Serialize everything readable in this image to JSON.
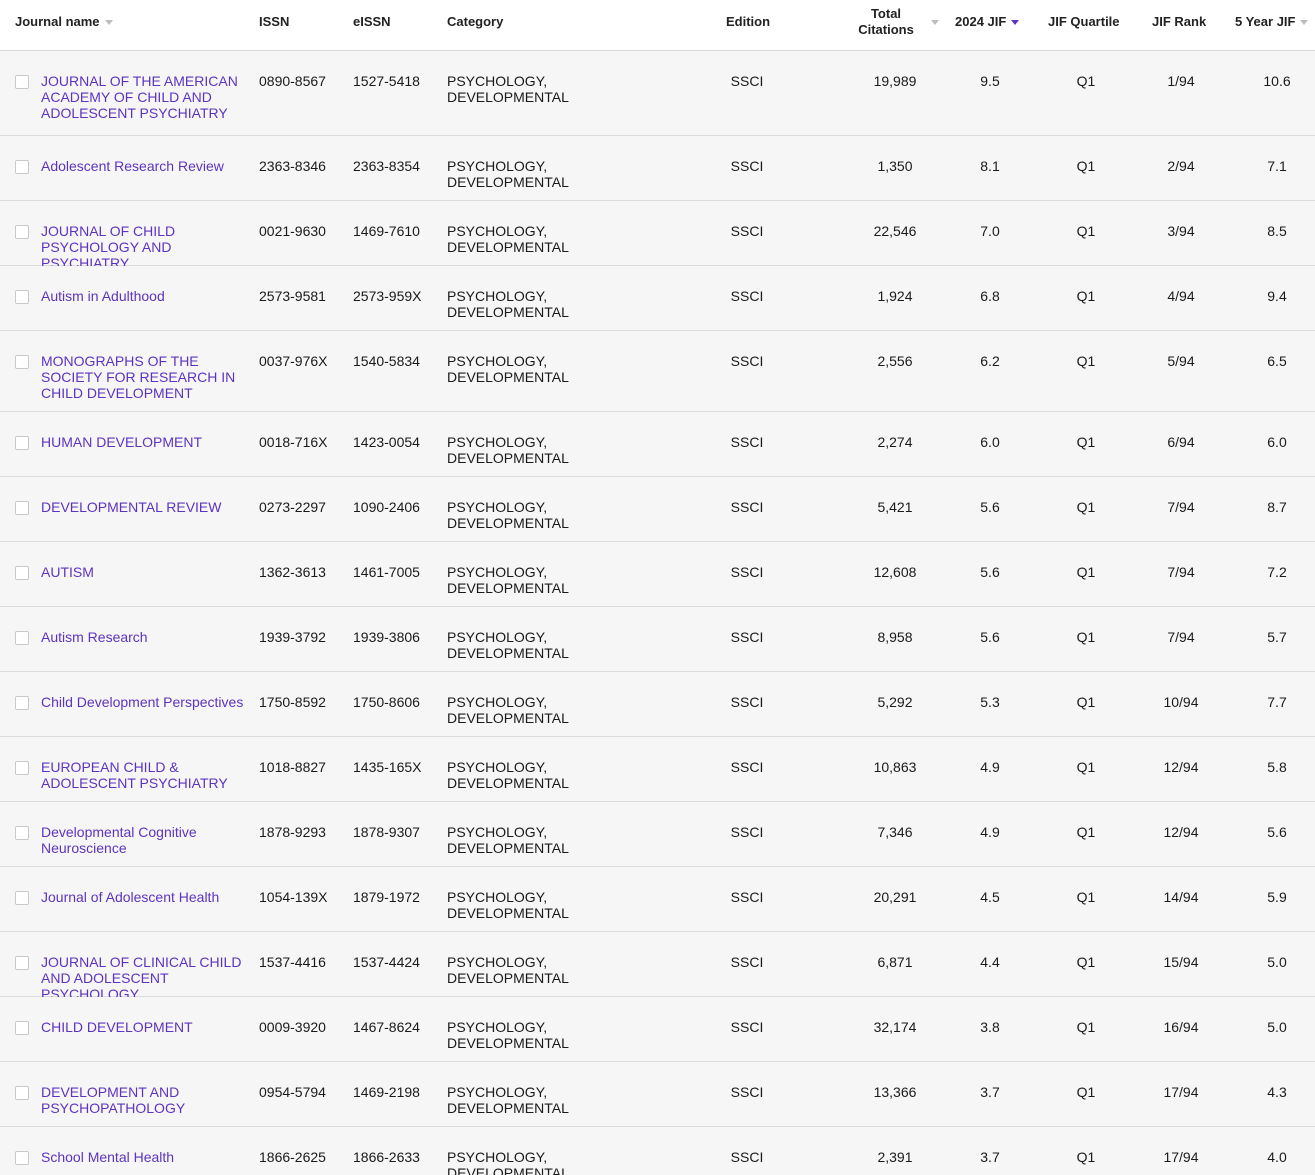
{
  "header": {
    "journal_name": "Journal name",
    "issn": "ISSN",
    "eissn": "eISSN",
    "category": "Category",
    "edition": "Edition",
    "total_citations_line1": "Total",
    "total_citations_line2": "Citations",
    "jif_2024": "2024 JIF",
    "jif_quartile": "JIF Quartile",
    "jif_rank": "JIF Rank",
    "five_year_jif": "5 Year JIF"
  },
  "colors": {
    "link": "#5e33bf",
    "row_background": "#f6f6f6",
    "active_sort": "#5e33bf"
  },
  "rows": [
    {
      "name": "JOURNAL OF THE AMERICAN ACADEMY OF CHILD AND ADOLESCENT PSYCHIATRY",
      "issn": "0890-8567",
      "eissn": "1527-5418",
      "category": "PSYCHOLOGY, DEVELOPMENTAL",
      "edition": "SSCI",
      "citations": "19,989",
      "jif": "9.5",
      "quartile": "Q1",
      "rank": "1/94",
      "fyjif": "10.6"
    },
    {
      "name": "Adolescent Research Review",
      "issn": "2363-8346",
      "eissn": "2363-8354",
      "category": "PSYCHOLOGY, DEVELOPMENTAL",
      "edition": "SSCI",
      "citations": "1,350",
      "jif": "8.1",
      "quartile": "Q1",
      "rank": "2/94",
      "fyjif": "7.1"
    },
    {
      "name": "JOURNAL OF CHILD PSYCHOLOGY AND PSYCHIATRY",
      "issn": "0021-9630",
      "eissn": "1469-7610",
      "category": "PSYCHOLOGY, DEVELOPMENTAL",
      "edition": "SSCI",
      "citations": "22,546",
      "jif": "7.0",
      "quartile": "Q1",
      "rank": "3/94",
      "fyjif": "8.5"
    },
    {
      "name": "Autism in Adulthood",
      "issn": "2573-9581",
      "eissn": "2573-959X",
      "category": "PSYCHOLOGY, DEVELOPMENTAL",
      "edition": "SSCI",
      "citations": "1,924",
      "jif": "6.8",
      "quartile": "Q1",
      "rank": "4/94",
      "fyjif": "9.4"
    },
    {
      "name": "MONOGRAPHS OF THE SOCIETY FOR RESEARCH IN CHILD DEVELOPMENT",
      "issn": "0037-976X",
      "eissn": "1540-5834",
      "category": "PSYCHOLOGY, DEVELOPMENTAL",
      "edition": "SSCI",
      "citations": "2,556",
      "jif": "6.2",
      "quartile": "Q1",
      "rank": "5/94",
      "fyjif": "6.5"
    },
    {
      "name": "HUMAN DEVELOPMENT",
      "issn": "0018-716X",
      "eissn": "1423-0054",
      "category": "PSYCHOLOGY, DEVELOPMENTAL",
      "edition": "SSCI",
      "citations": "2,274",
      "jif": "6.0",
      "quartile": "Q1",
      "rank": "6/94",
      "fyjif": "6.0"
    },
    {
      "name": "DEVELOPMENTAL REVIEW",
      "issn": "0273-2297",
      "eissn": "1090-2406",
      "category": "PSYCHOLOGY, DEVELOPMENTAL",
      "edition": "SSCI",
      "citations": "5,421",
      "jif": "5.6",
      "quartile": "Q1",
      "rank": "7/94",
      "fyjif": "8.7"
    },
    {
      "name": "AUTISM",
      "issn": "1362-3613",
      "eissn": "1461-7005",
      "category": "PSYCHOLOGY, DEVELOPMENTAL",
      "edition": "SSCI",
      "citations": "12,608",
      "jif": "5.6",
      "quartile": "Q1",
      "rank": "7/94",
      "fyjif": "7.2"
    },
    {
      "name": "Autism Research",
      "issn": "1939-3792",
      "eissn": "1939-3806",
      "category": "PSYCHOLOGY, DEVELOPMENTAL",
      "edition": "SSCI",
      "citations": "8,958",
      "jif": "5.6",
      "quartile": "Q1",
      "rank": "7/94",
      "fyjif": "5.7"
    },
    {
      "name": "Child Development Perspectives",
      "issn": "1750-8592",
      "eissn": "1750-8606",
      "category": "PSYCHOLOGY, DEVELOPMENTAL",
      "edition": "SSCI",
      "citations": "5,292",
      "jif": "5.3",
      "quartile": "Q1",
      "rank": "10/94",
      "fyjif": "7.7"
    },
    {
      "name": "EUROPEAN CHILD & ADOLESCENT PSYCHIATRY",
      "issn": "1018-8827",
      "eissn": "1435-165X",
      "category": "PSYCHOLOGY, DEVELOPMENTAL",
      "edition": "SSCI",
      "citations": "10,863",
      "jif": "4.9",
      "quartile": "Q1",
      "rank": "12/94",
      "fyjif": "5.8"
    },
    {
      "name": "Developmental Cognitive Neuroscience",
      "issn": "1878-9293",
      "eissn": "1878-9307",
      "category": "PSYCHOLOGY, DEVELOPMENTAL",
      "edition": "SSCI",
      "citations": "7,346",
      "jif": "4.9",
      "quartile": "Q1",
      "rank": "12/94",
      "fyjif": "5.6"
    },
    {
      "name": "Journal of Adolescent Health",
      "issn": "1054-139X",
      "eissn": "1879-1972",
      "category": "PSYCHOLOGY, DEVELOPMENTAL",
      "edition": "SSCI",
      "citations": "20,291",
      "jif": "4.5",
      "quartile": "Q1",
      "rank": "14/94",
      "fyjif": "5.9"
    },
    {
      "name": "JOURNAL OF CLINICAL CHILD AND ADOLESCENT PSYCHOLOGY",
      "issn": "1537-4416",
      "eissn": "1537-4424",
      "category": "PSYCHOLOGY, DEVELOPMENTAL",
      "edition": "SSCI",
      "citations": "6,871",
      "jif": "4.4",
      "quartile": "Q1",
      "rank": "15/94",
      "fyjif": "5.0"
    },
    {
      "name": "CHILD DEVELOPMENT",
      "issn": "0009-3920",
      "eissn": "1467-8624",
      "category": "PSYCHOLOGY, DEVELOPMENTAL",
      "edition": "SSCI",
      "citations": "32,174",
      "jif": "3.8",
      "quartile": "Q1",
      "rank": "16/94",
      "fyjif": "5.0"
    },
    {
      "name": "DEVELOPMENT AND PSYCHOPATHOLOGY",
      "issn": "0954-5794",
      "eissn": "1469-2198",
      "category": "PSYCHOLOGY, DEVELOPMENTAL",
      "edition": "SSCI",
      "citations": "13,366",
      "jif": "3.7",
      "quartile": "Q1",
      "rank": "17/94",
      "fyjif": "4.3"
    },
    {
      "name": "School Mental Health",
      "issn": "1866-2625",
      "eissn": "1866-2633",
      "category": "PSYCHOLOGY, DEVELOPMENTAL",
      "edition": "SSCI",
      "citations": "2,391",
      "jif": "3.7",
      "quartile": "Q1",
      "rank": "17/94",
      "fyjif": "4.0"
    }
  ]
}
